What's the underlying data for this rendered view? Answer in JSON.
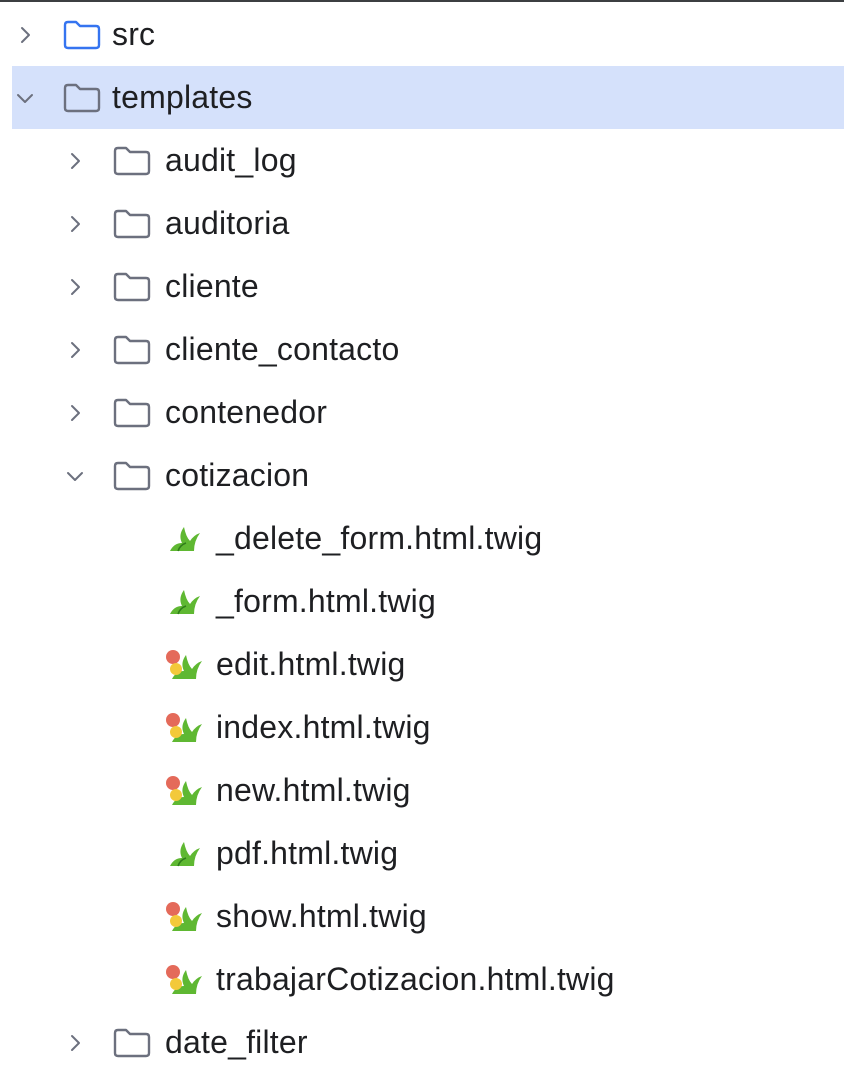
{
  "tree": {
    "items": [
      {
        "label": "src",
        "kind": "folder",
        "expanded": false,
        "depth": 0,
        "folder_icon": "source-folder-icon"
      },
      {
        "label": "templates",
        "kind": "folder",
        "expanded": true,
        "depth": 0,
        "selected": true,
        "folder_icon": "folder-icon"
      },
      {
        "label": "audit_log",
        "kind": "folder",
        "expanded": false,
        "depth": 1,
        "folder_icon": "folder-icon"
      },
      {
        "label": "auditoria",
        "kind": "folder",
        "expanded": false,
        "depth": 1,
        "folder_icon": "folder-icon"
      },
      {
        "label": "cliente",
        "kind": "folder",
        "expanded": false,
        "depth": 1,
        "folder_icon": "folder-icon"
      },
      {
        "label": "cliente_contacto",
        "kind": "folder",
        "expanded": false,
        "depth": 1,
        "folder_icon": "folder-icon"
      },
      {
        "label": "contenedor",
        "kind": "folder",
        "expanded": false,
        "depth": 1,
        "folder_icon": "folder-icon"
      },
      {
        "label": "cotizacion",
        "kind": "folder",
        "expanded": true,
        "depth": 1,
        "folder_icon": "folder-icon"
      },
      {
        "label": "_delete_form.html.twig",
        "kind": "file",
        "depth": 2,
        "file_icon": "twig-file-icon"
      },
      {
        "label": "_form.html.twig",
        "kind": "file",
        "depth": 2,
        "file_icon": "twig-file-icon"
      },
      {
        "label": "edit.html.twig",
        "kind": "file",
        "depth": 2,
        "file_icon": "twig-file-modified-icon"
      },
      {
        "label": "index.html.twig",
        "kind": "file",
        "depth": 2,
        "file_icon": "twig-file-modified-icon"
      },
      {
        "label": "new.html.twig",
        "kind": "file",
        "depth": 2,
        "file_icon": "twig-file-modified-icon"
      },
      {
        "label": "pdf.html.twig",
        "kind": "file",
        "depth": 2,
        "file_icon": "twig-file-icon"
      },
      {
        "label": "show.html.twig",
        "kind": "file",
        "depth": 2,
        "file_icon": "twig-file-modified-icon"
      },
      {
        "label": "trabajarCotizacion.html.twig",
        "kind": "file",
        "depth": 2,
        "file_icon": "twig-file-modified-icon"
      },
      {
        "label": "date_filter",
        "kind": "folder",
        "expanded": false,
        "depth": 1,
        "folder_icon": "folder-icon"
      }
    ]
  },
  "colors": {
    "selection_bg": "#d5e1fb",
    "source_folder": "#3574f0",
    "folder_outline": "#6c707e",
    "twig_green": "#5fb832",
    "modified_dot": "#e46a5a",
    "modified_dot_yellow": "#f3c93a"
  }
}
